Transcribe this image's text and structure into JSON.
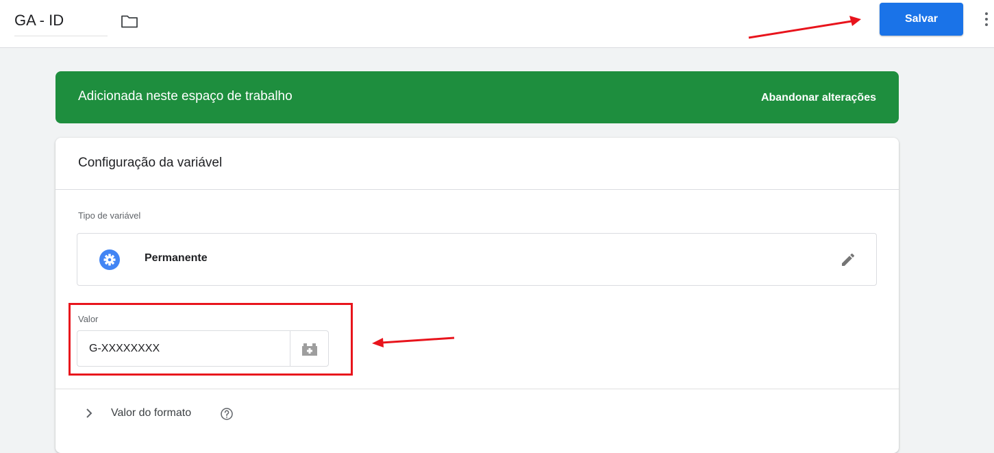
{
  "header": {
    "title": "GA - ID",
    "save_label": "Salvar"
  },
  "banner": {
    "text": "Adicionada neste espaço de trabalho",
    "discard_label": "Abandonar alterações"
  },
  "card": {
    "title": "Configuração da variável",
    "type_label": "Tipo de variável",
    "type_value": "Permanente",
    "value_label": "Valor",
    "value": "G-XXXXXXXX",
    "format_label": "Valor do formato"
  },
  "colors": {
    "brand_blue": "#1a73e8",
    "banner_green": "#1e8e3e",
    "annotation_red": "#e8141c"
  },
  "icons": [
    "folder-icon",
    "more-vert-icon",
    "settings-gear-icon",
    "edit-pencil-icon",
    "variable-block-icon",
    "chevron-right-icon",
    "help-icon"
  ]
}
